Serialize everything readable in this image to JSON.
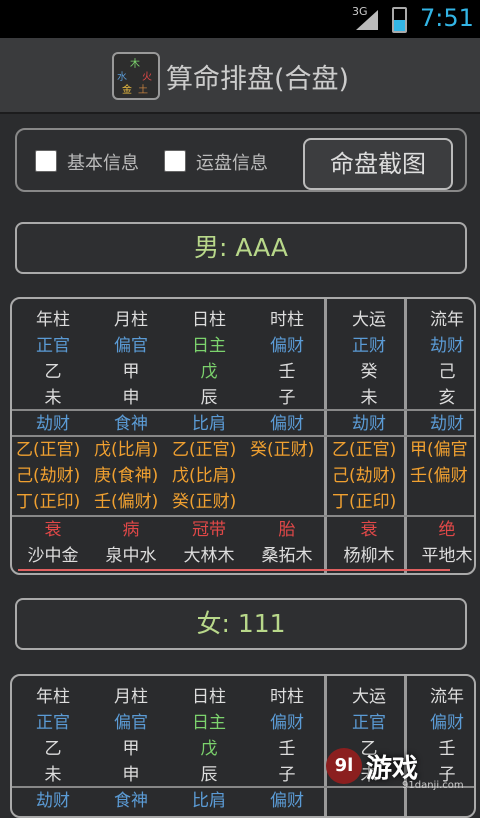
{
  "status": {
    "signal": "3G",
    "time": "7:51"
  },
  "app": {
    "title": "算命排盘(合盘)",
    "logo_chars": [
      "木",
      "水",
      "火",
      "金",
      "土"
    ]
  },
  "options": {
    "basic_info": "基本信息",
    "luck_info": "运盘信息",
    "screenshot": "命盘截图"
  },
  "male": {
    "label": "男: AAA",
    "headers": [
      "年柱",
      "月柱",
      "日柱",
      "时柱",
      "大运",
      "流年"
    ],
    "gods_top": [
      "正官",
      "偏官",
      "日主",
      "偏财",
      "正财",
      "劫财"
    ],
    "stems": [
      "乙",
      "甲",
      "戊",
      "壬",
      "癸",
      "己"
    ],
    "branches": [
      "未",
      "申",
      "辰",
      "子",
      "未",
      "亥"
    ],
    "gods_bottom": [
      "劫财",
      "食神",
      "比肩",
      "偏财",
      "劫财",
      "劫财"
    ],
    "hidden": [
      [
        "乙(正官)",
        "己(劫财)",
        "丁(正印)"
      ],
      [
        "戊(比肩)",
        "庚(食神)",
        "壬(偏财)"
      ],
      [
        "乙(正官)",
        "戊(比肩)",
        "癸(正财)"
      ],
      [
        "癸(正财)"
      ],
      [
        "乙(正官)",
        "己(劫财)",
        "丁(正印)"
      ],
      [
        "甲(偏官",
        "壬(偏财"
      ]
    ],
    "phases": [
      "衰",
      "病",
      "冠带",
      "胎",
      "衰",
      "绝"
    ],
    "nayin": [
      "沙中金",
      "泉中水",
      "大林木",
      "桑拓木",
      "杨柳木",
      "平地木"
    ]
  },
  "female": {
    "label": "女: 111",
    "headers": [
      "年柱",
      "月柱",
      "日柱",
      "时柱",
      "大运",
      "流年"
    ],
    "gods_top": [
      "正官",
      "偏官",
      "日主",
      "偏财",
      "正官",
      "偏财"
    ],
    "stems": [
      "乙",
      "甲",
      "戊",
      "壬",
      "乙",
      "壬"
    ],
    "branches": [
      "未",
      "申",
      "辰",
      "子",
      "未",
      "子"
    ],
    "gods_bottom": [
      "劫财",
      "食神",
      "比肩",
      "偏财",
      "",
      ""
    ]
  },
  "watermark": {
    "main": "游戏",
    "logo": "9l",
    "sub": "91danji.com"
  }
}
